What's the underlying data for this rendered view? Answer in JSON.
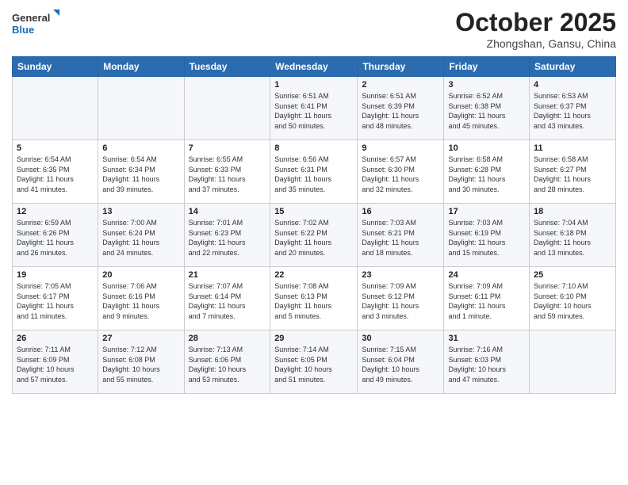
{
  "header": {
    "logo_line1": "General",
    "logo_line2": "Blue",
    "month": "October 2025",
    "location": "Zhongshan, Gansu, China"
  },
  "weekdays": [
    "Sunday",
    "Monday",
    "Tuesday",
    "Wednesday",
    "Thursday",
    "Friday",
    "Saturday"
  ],
  "weeks": [
    [
      {
        "num": "",
        "detail": ""
      },
      {
        "num": "",
        "detail": ""
      },
      {
        "num": "",
        "detail": ""
      },
      {
        "num": "1",
        "detail": "Sunrise: 6:51 AM\nSunset: 6:41 PM\nDaylight: 11 hours\nand 50 minutes."
      },
      {
        "num": "2",
        "detail": "Sunrise: 6:51 AM\nSunset: 6:39 PM\nDaylight: 11 hours\nand 48 minutes."
      },
      {
        "num": "3",
        "detail": "Sunrise: 6:52 AM\nSunset: 6:38 PM\nDaylight: 11 hours\nand 45 minutes."
      },
      {
        "num": "4",
        "detail": "Sunrise: 6:53 AM\nSunset: 6:37 PM\nDaylight: 11 hours\nand 43 minutes."
      }
    ],
    [
      {
        "num": "5",
        "detail": "Sunrise: 6:54 AM\nSunset: 6:35 PM\nDaylight: 11 hours\nand 41 minutes."
      },
      {
        "num": "6",
        "detail": "Sunrise: 6:54 AM\nSunset: 6:34 PM\nDaylight: 11 hours\nand 39 minutes."
      },
      {
        "num": "7",
        "detail": "Sunrise: 6:55 AM\nSunset: 6:33 PM\nDaylight: 11 hours\nand 37 minutes."
      },
      {
        "num": "8",
        "detail": "Sunrise: 6:56 AM\nSunset: 6:31 PM\nDaylight: 11 hours\nand 35 minutes."
      },
      {
        "num": "9",
        "detail": "Sunrise: 6:57 AM\nSunset: 6:30 PM\nDaylight: 11 hours\nand 32 minutes."
      },
      {
        "num": "10",
        "detail": "Sunrise: 6:58 AM\nSunset: 6:28 PM\nDaylight: 11 hours\nand 30 minutes."
      },
      {
        "num": "11",
        "detail": "Sunrise: 6:58 AM\nSunset: 6:27 PM\nDaylight: 11 hours\nand 28 minutes."
      }
    ],
    [
      {
        "num": "12",
        "detail": "Sunrise: 6:59 AM\nSunset: 6:26 PM\nDaylight: 11 hours\nand 26 minutes."
      },
      {
        "num": "13",
        "detail": "Sunrise: 7:00 AM\nSunset: 6:24 PM\nDaylight: 11 hours\nand 24 minutes."
      },
      {
        "num": "14",
        "detail": "Sunrise: 7:01 AM\nSunset: 6:23 PM\nDaylight: 11 hours\nand 22 minutes."
      },
      {
        "num": "15",
        "detail": "Sunrise: 7:02 AM\nSunset: 6:22 PM\nDaylight: 11 hours\nand 20 minutes."
      },
      {
        "num": "16",
        "detail": "Sunrise: 7:03 AM\nSunset: 6:21 PM\nDaylight: 11 hours\nand 18 minutes."
      },
      {
        "num": "17",
        "detail": "Sunrise: 7:03 AM\nSunset: 6:19 PM\nDaylight: 11 hours\nand 15 minutes."
      },
      {
        "num": "18",
        "detail": "Sunrise: 7:04 AM\nSunset: 6:18 PM\nDaylight: 11 hours\nand 13 minutes."
      }
    ],
    [
      {
        "num": "19",
        "detail": "Sunrise: 7:05 AM\nSunset: 6:17 PM\nDaylight: 11 hours\nand 11 minutes."
      },
      {
        "num": "20",
        "detail": "Sunrise: 7:06 AM\nSunset: 6:16 PM\nDaylight: 11 hours\nand 9 minutes."
      },
      {
        "num": "21",
        "detail": "Sunrise: 7:07 AM\nSunset: 6:14 PM\nDaylight: 11 hours\nand 7 minutes."
      },
      {
        "num": "22",
        "detail": "Sunrise: 7:08 AM\nSunset: 6:13 PM\nDaylight: 11 hours\nand 5 minutes."
      },
      {
        "num": "23",
        "detail": "Sunrise: 7:09 AM\nSunset: 6:12 PM\nDaylight: 11 hours\nand 3 minutes."
      },
      {
        "num": "24",
        "detail": "Sunrise: 7:09 AM\nSunset: 6:11 PM\nDaylight: 11 hours\nand 1 minute."
      },
      {
        "num": "25",
        "detail": "Sunrise: 7:10 AM\nSunset: 6:10 PM\nDaylight: 10 hours\nand 59 minutes."
      }
    ],
    [
      {
        "num": "26",
        "detail": "Sunrise: 7:11 AM\nSunset: 6:09 PM\nDaylight: 10 hours\nand 57 minutes."
      },
      {
        "num": "27",
        "detail": "Sunrise: 7:12 AM\nSunset: 6:08 PM\nDaylight: 10 hours\nand 55 minutes."
      },
      {
        "num": "28",
        "detail": "Sunrise: 7:13 AM\nSunset: 6:06 PM\nDaylight: 10 hours\nand 53 minutes."
      },
      {
        "num": "29",
        "detail": "Sunrise: 7:14 AM\nSunset: 6:05 PM\nDaylight: 10 hours\nand 51 minutes."
      },
      {
        "num": "30",
        "detail": "Sunrise: 7:15 AM\nSunset: 6:04 PM\nDaylight: 10 hours\nand 49 minutes."
      },
      {
        "num": "31",
        "detail": "Sunrise: 7:16 AM\nSunset: 6:03 PM\nDaylight: 10 hours\nand 47 minutes."
      },
      {
        "num": "",
        "detail": ""
      }
    ]
  ]
}
